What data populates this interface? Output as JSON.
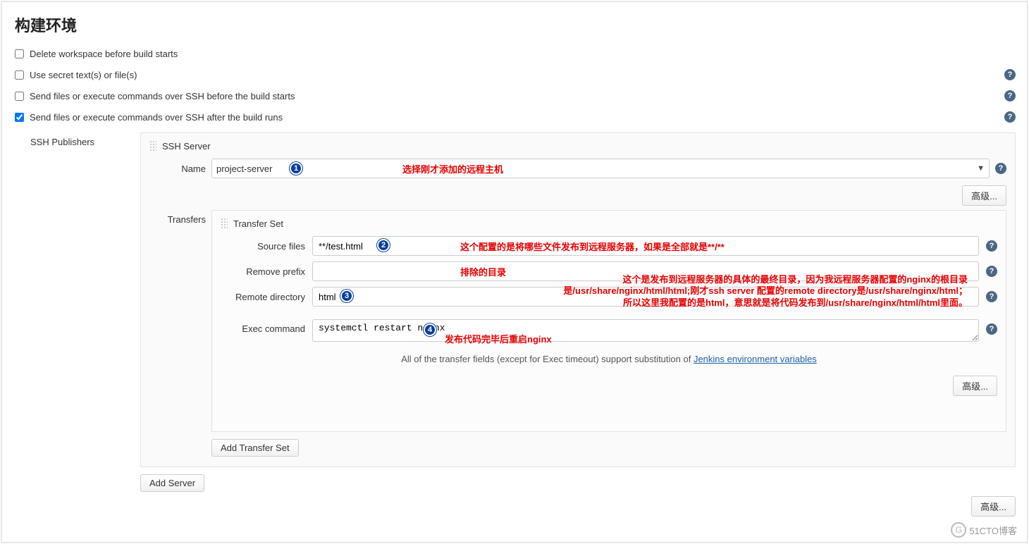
{
  "section_title": "构建环境",
  "options": {
    "delete_workspace": "Delete workspace before build starts",
    "use_secret": "Use secret text(s) or file(s)",
    "ssh_before": "Send files or execute commands over SSH before the build starts",
    "ssh_after": "Send files or execute commands over SSH after the build runs"
  },
  "publishers": {
    "label": "SSH Publishers",
    "ssh_server_heading": "SSH Server",
    "name_label": "Name",
    "name_value": "project-server",
    "advanced_label": "高级...",
    "transfers_label": "Transfers",
    "transfer_set_heading": "Transfer Set",
    "fields": {
      "source_files_label": "Source files",
      "source_files_value": "**/test.html",
      "remove_prefix_label": "Remove prefix",
      "remove_prefix_value": "",
      "remote_directory_label": "Remote directory",
      "remote_directory_value": "html",
      "exec_command_label": "Exec command",
      "exec_command_value": "systemctl restart nginx"
    },
    "hint_prefix": "All of the transfer fields (except for Exec timeout) support substitution of ",
    "hint_link": "Jenkins environment variables",
    "add_transfer_set": "Add Transfer Set",
    "add_server": "Add Server",
    "bottom_advanced": "高级..."
  },
  "annotations": {
    "a1": "选择刚才添加的远程主机",
    "a2": "这个配置的是将哪些文件发布到远程服务器，如果是全部就是**/**",
    "a3": "排除的目录",
    "a4_line1": "这个是发布到远程服务器的具体的最终目录，因为我远程服务器配置的nginx的根目录",
    "a4_line2": "是/usr/share/nginx/html/html;刚才ssh server 配置的remote directory是/usr/share/nginx/html；",
    "a4_line3": "所以这里我配置的是html，意思就是将代码发布到/usr/share/nginx/html/html里面。",
    "a5": "发布代码完毕后重启nginx"
  },
  "badges": {
    "b1": "1",
    "b2": "2",
    "b3": "3",
    "b4": "4"
  },
  "watermark": "51CTO博客"
}
